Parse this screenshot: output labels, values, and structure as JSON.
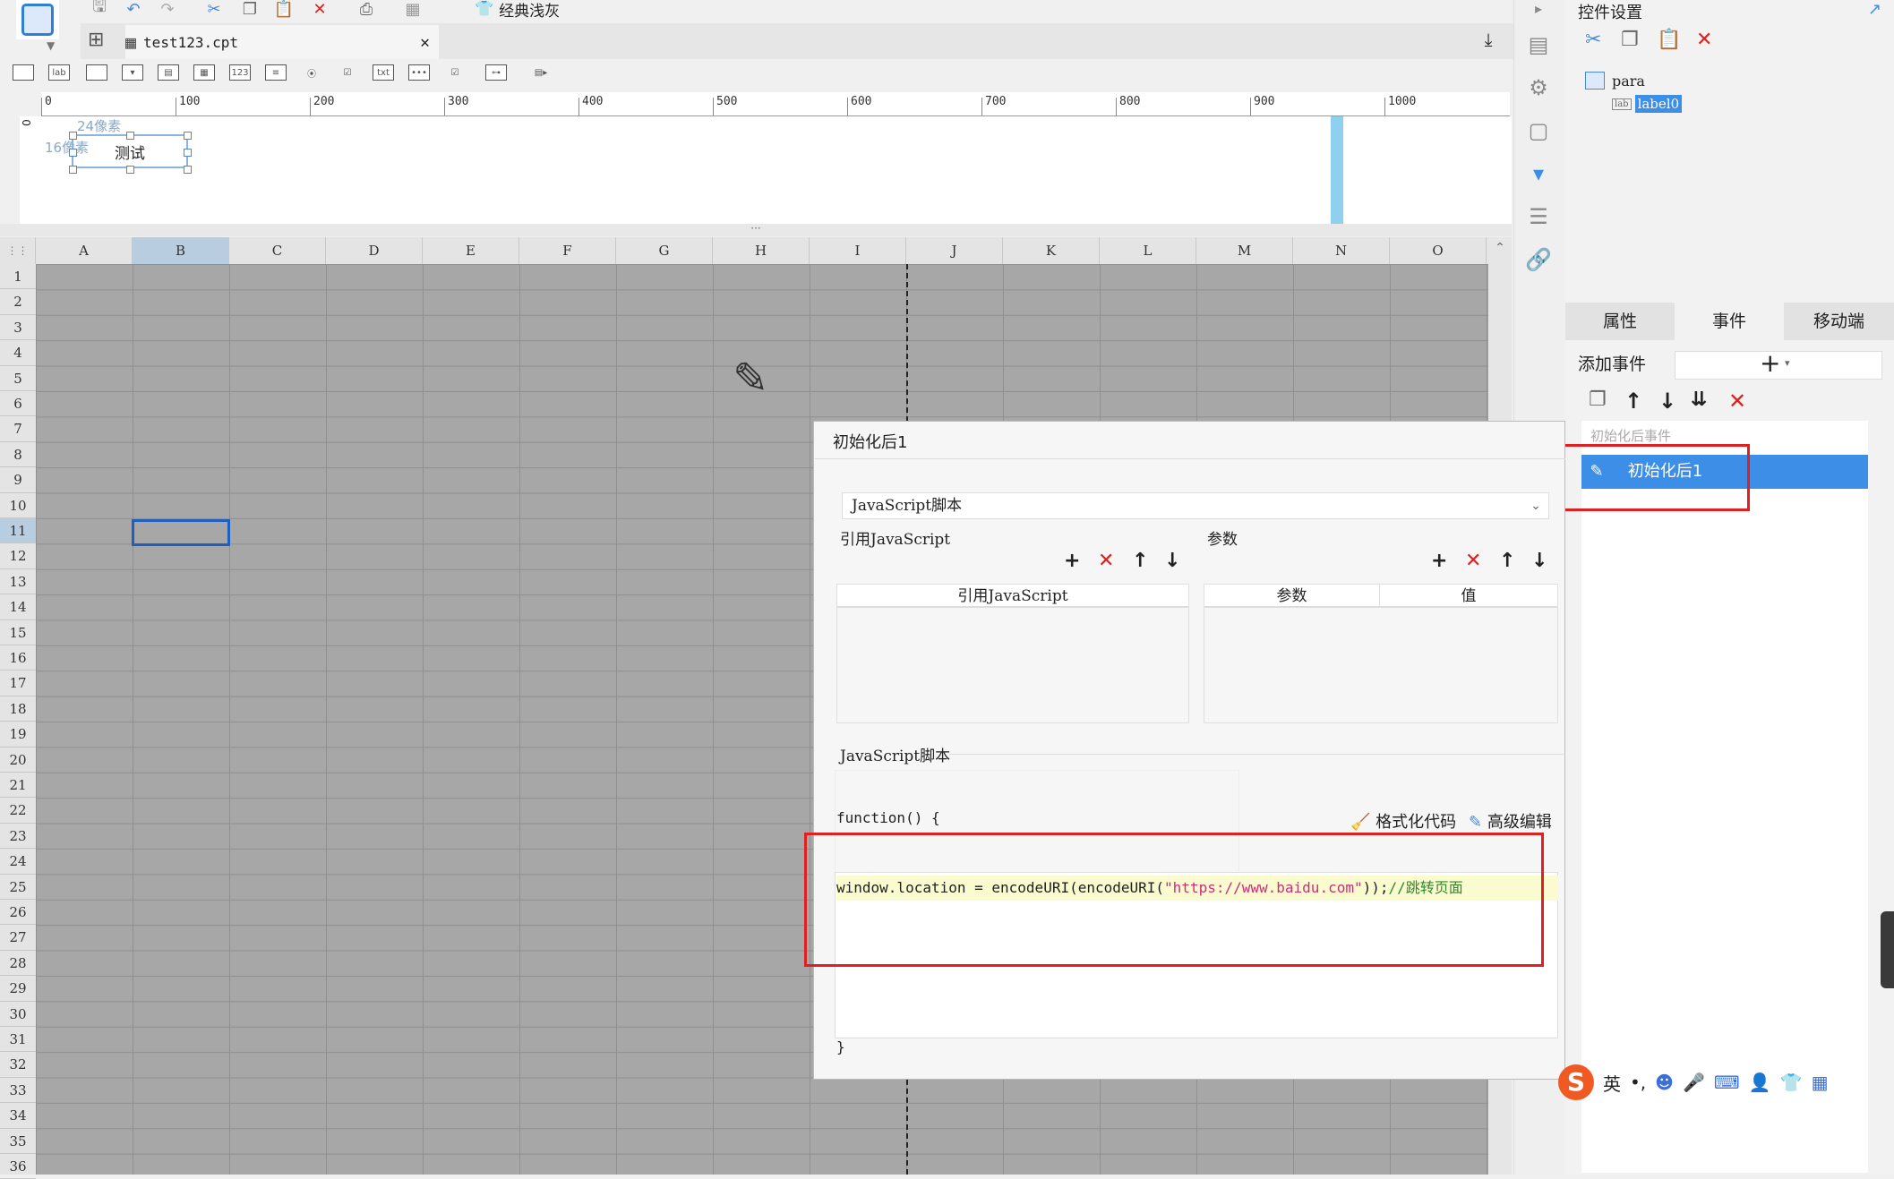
{
  "toolbar": {
    "theme_label": "经典浅灰"
  },
  "file_tab": {
    "name": "test123.cpt",
    "close": "✕"
  },
  "ruler": {
    "ticks": [
      "0",
      "100",
      "200",
      "300",
      "400",
      "500",
      "600",
      "700",
      "800",
      "900",
      "1000"
    ],
    "vertical_zero": "0"
  },
  "param_canvas": {
    "label_text": "测试",
    "width_annotation": "24像素",
    "height_annotation": "16像素"
  },
  "splitter": {
    "grip": "···"
  },
  "grid": {
    "columns": [
      "A",
      "B",
      "C",
      "D",
      "E",
      "F",
      "G",
      "H",
      "I",
      "J",
      "K",
      "L",
      "M",
      "N",
      "O"
    ],
    "rows": [
      "1",
      "2",
      "3",
      "4",
      "5",
      "6",
      "7",
      "8",
      "9",
      "10",
      "11",
      "12",
      "13",
      "14",
      "15",
      "16",
      "17",
      "18",
      "19",
      "20",
      "21",
      "22",
      "23",
      "24",
      "25",
      "26",
      "27",
      "28",
      "29",
      "30",
      "31",
      "32",
      "33",
      "34",
      "35",
      "36"
    ],
    "selected_column": "B",
    "selected_row": "11"
  },
  "right_panel": {
    "title": "控件设置",
    "tree": {
      "root": "para",
      "child": "label0",
      "child_icon_text": "lab"
    },
    "tabs": [
      "属性",
      "事件",
      "移动端"
    ],
    "add_event_label": "添加事件",
    "add_symbol": "+",
    "event_group": "初始化后事件",
    "event_item": "初始化后1"
  },
  "dialog": {
    "title": "初始化后1",
    "script_type": "JavaScript脚本",
    "ref_js_label": "引用JavaScript",
    "params_label": "参数",
    "ref_js_col": "引用JavaScript",
    "param_col": "参数",
    "value_col": "值",
    "script_label": "JavaScript脚本",
    "code_open": "function() {",
    "format_btn": "格式化代码",
    "advanced_btn": "高级编辑",
    "code": {
      "p1": "window.location = encodeURI(encodeURI(",
      "p2": "\"https://www.baidu.com\"",
      "p3": "));",
      "p4": "//跳转页面"
    },
    "code_close": "}"
  },
  "ime": {
    "lang": "英",
    "punct": "•,"
  },
  "colors": {
    "accent": "#3c8ee6",
    "highlight": "#e02020",
    "grid": "#a7a7a7"
  }
}
